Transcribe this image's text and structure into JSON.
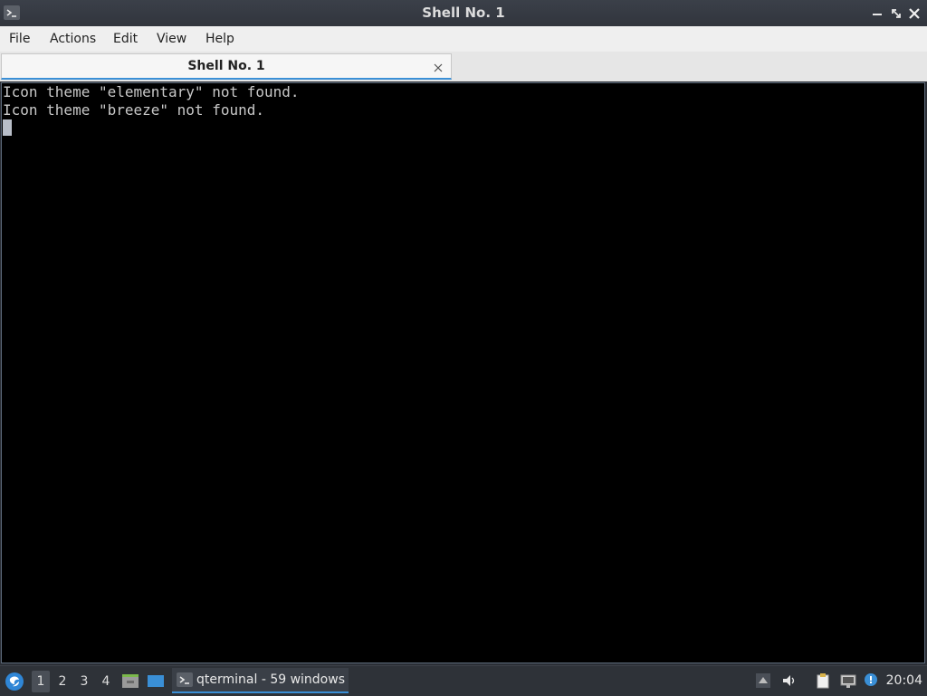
{
  "window": {
    "title": "Shell No. 1"
  },
  "menubar": {
    "items": [
      "File",
      "Actions",
      "Edit",
      "View",
      "Help"
    ]
  },
  "tabs": [
    {
      "label": "Shell No. 1",
      "active": true
    }
  ],
  "terminal": {
    "lines": [
      "Icon theme \"elementary\" not found.",
      "Icon theme \"breeze\" not found."
    ]
  },
  "taskbar": {
    "desktops": [
      "1",
      "2",
      "3",
      "4"
    ],
    "active_desktop": "1",
    "task_label": "qterminal - 59 windows",
    "clock": "20:04"
  },
  "colors": {
    "accent": "#3a8fd6",
    "titlebar": "#353941",
    "terminal_bg": "#000000",
    "terminal_fg": "#c8c8c8"
  },
  "icons": {
    "app": "terminal-icon",
    "start": "lxqt-start-icon",
    "file_manager": "file-manager-icon",
    "show_desktop": "show-desktop-icon",
    "tray": [
      "tray-up-arrow-icon",
      "volume-icon",
      "clipboard-icon",
      "network-icon",
      "update-notifier-icon"
    ]
  }
}
